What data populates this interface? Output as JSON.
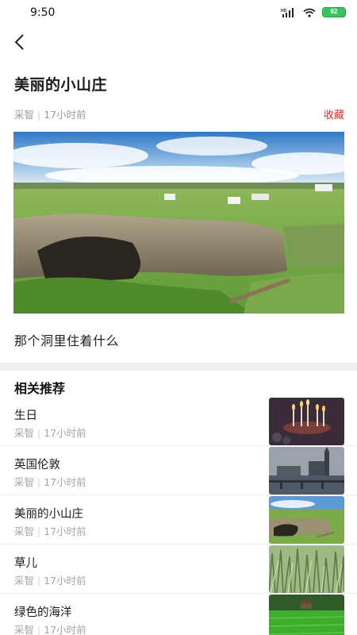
{
  "status_bar": {
    "time": "9:50",
    "network": "HD",
    "battery": "92",
    "icons": [
      "signal-icon",
      "wifi-icon",
      "battery-icon"
    ]
  },
  "nav": {
    "back_icon": "chevron-left-icon"
  },
  "article": {
    "title": "美丽的小山庄",
    "author": "采智",
    "separator": "|",
    "time": "17小时前",
    "favorite_label": "收藏",
    "favorite_color": "#d9302c",
    "image": "coastal-cave-landscape",
    "caption": "那个洞里住着什么"
  },
  "related": {
    "heading": "相关推荐",
    "items": [
      {
        "title": "生日",
        "author": "采智",
        "separator": "|",
        "time": "17小时前",
        "thumb": "birthday-candles"
      },
      {
        "title": "英国伦敦",
        "author": "采智",
        "separator": "|",
        "time": "17小时前",
        "thumb": "london-skyline"
      },
      {
        "title": "美丽的小山庄",
        "author": "采智",
        "separator": "|",
        "time": "17小时前",
        "thumb": "coastal-cave-landscape"
      },
      {
        "title": "草儿",
        "author": "采智",
        "separator": "|",
        "time": "17小时前",
        "thumb": "tall-grass"
      },
      {
        "title": "绿色的海洋",
        "author": "采智",
        "separator": "|",
        "time": "17小时前",
        "thumb": "green-field"
      }
    ]
  }
}
